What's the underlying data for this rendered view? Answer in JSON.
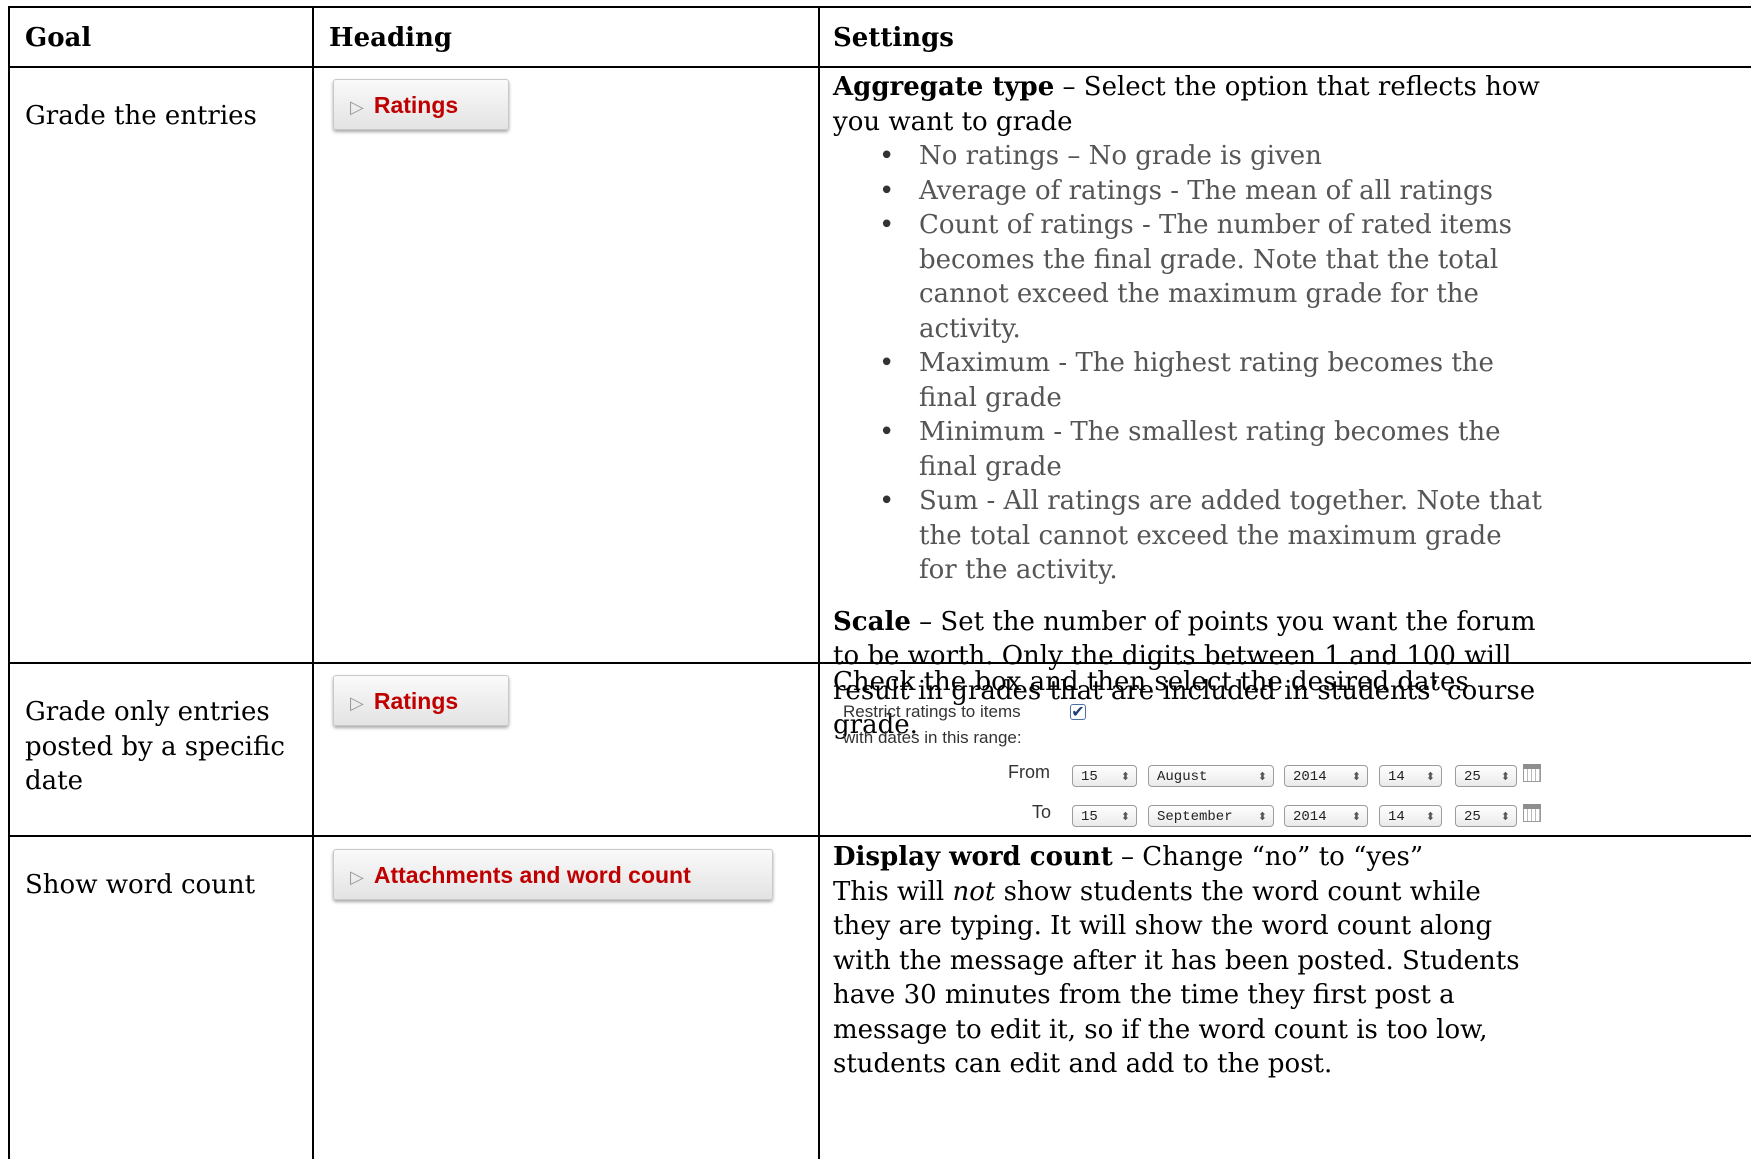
{
  "headers": {
    "goal": "Goal",
    "heading": "Heading",
    "settings": "Settings"
  },
  "rows": [
    {
      "goal": "Grade the entries",
      "button": "Ratings",
      "settings": {
        "aggregate_term": "Aggregate type",
        "aggregate_text": " – Select the option that reflects how you want to grade",
        "items": [
          "No ratings – No grade is given",
          "Average of ratings - The mean of all ratings",
          "Count of ratings - The number of rated items becomes the final grade. Note that the total cannot exceed the maximum grade for the activity.",
          "Maximum - The highest rating becomes the final grade",
          "Minimum - The smallest rating becomes the final grade",
          "Sum - All ratings are added together. Note that the total cannot exceed the maximum grade for the activity."
        ],
        "scale_term": "Scale",
        "scale_text": " – Set the number of points you want the forum to be worth.  Only the digits between 1 and 100 will result in grades that are included in students’ course grade."
      }
    },
    {
      "goal": "Grade only entries posted by a specific date",
      "button": "Ratings",
      "settings": {
        "intro": "Check the box and then select the desired dates",
        "restrict_label_1": "Restrict ratings to items",
        "restrict_label_2": "with dates in this range:",
        "restrict_checked": true,
        "from_label": "From",
        "to_label": "To",
        "from": {
          "day": "15",
          "month": "August",
          "year": "2014",
          "hour": "14",
          "minute": "25"
        },
        "to": {
          "day": "15",
          "month": "September",
          "year": "2014",
          "hour": "14",
          "minute": "25"
        }
      }
    },
    {
      "goal": "Show word count",
      "button": "Attachments and word count",
      "settings": {
        "wc_term": "Display word count",
        "wc_text": " – Change “no” to “yes”",
        "body_a": "This will ",
        "body_em": "not",
        "body_b": " show students the word count while they are typing. It will show the word count along with the message after it has been posted. Students have 30 minutes from the time they first post a message to edit it, so if the word count is too low, students can edit and add to the post."
      }
    }
  ]
}
